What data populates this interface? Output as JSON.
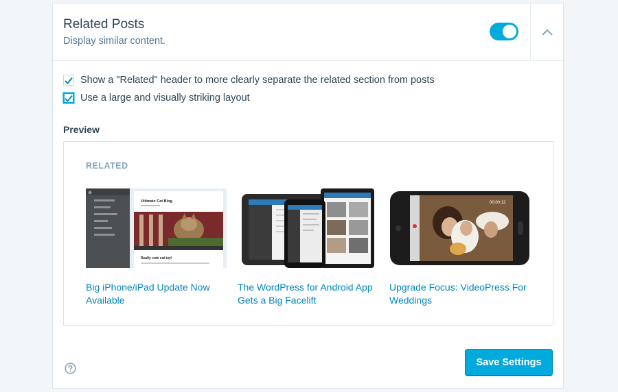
{
  "header": {
    "title": "Related Posts",
    "description": "Display similar content.",
    "enabled": true
  },
  "options": [
    {
      "label": "Show a \"Related\" header to more clearly separate the related section from posts",
      "checked": true
    },
    {
      "label": "Use a large and visually striking layout",
      "checked": true
    }
  ],
  "preview": {
    "label": "Preview",
    "heading": "RELATED",
    "items": [
      {
        "title": "Big iPhone/iPad Update Now Available",
        "thumb_icon": "tablet-blog-screenshot"
      },
      {
        "title": "The WordPress for Android App Gets a Big Facelift",
        "thumb_icon": "android-devices-photo"
      },
      {
        "title": "Upgrade Focus: VideoPress For Weddings",
        "thumb_icon": "phone-video-photo"
      }
    ]
  },
  "thumb1": {
    "blog_title": "Ultimate Cat Blog",
    "post_title": "Really cute cat toy!"
  },
  "thumb3": {
    "timecode": "00:00:12"
  },
  "footer": {
    "help_icon": "question-circle-icon",
    "save_label": "Save Settings"
  },
  "colors": {
    "accent": "#00aadc",
    "link": "#0087be",
    "heading_muted": "#87a6bc"
  }
}
